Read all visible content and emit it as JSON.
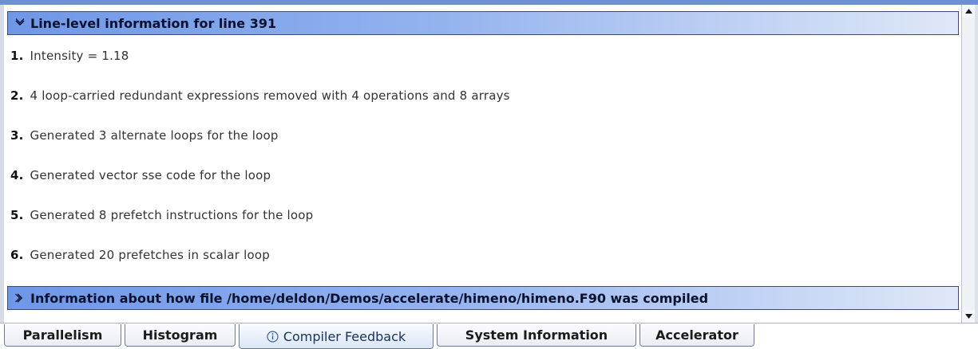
{
  "section_line": {
    "title": "Line-level information for line 391",
    "items": [
      {
        "num": "1.",
        "text": "Intensity = 1.18"
      },
      {
        "num": "2.",
        "text": "4 loop-carried redundant expressions removed with 4 operations and 8 arrays"
      },
      {
        "num": "3.",
        "text": "Generated 3 alternate loops for the loop"
      },
      {
        "num": "4.",
        "text": "Generated vector sse code for the loop"
      },
      {
        "num": "5.",
        "text": "Generated 8 prefetch instructions for the loop"
      },
      {
        "num": "6.",
        "text": "Generated 20 prefetches in scalar loop"
      }
    ]
  },
  "section_file": {
    "title": "Information about how file /home/deldon/Demos/accelerate/himeno/himeno.F90 was compiled"
  },
  "tabs": [
    {
      "label": "Parallelism",
      "active": false
    },
    {
      "label": "Histogram",
      "active": false
    },
    {
      "label": "Compiler Feedback",
      "active": true,
      "icon": "info-icon"
    },
    {
      "label": "System Information",
      "active": false
    },
    {
      "label": "Accelerator",
      "active": false
    }
  ],
  "colors": {
    "header_gradient_start": "#6f97e8",
    "header_gradient_end": "#dfe8f7",
    "top_border": "#6d8fd6"
  }
}
